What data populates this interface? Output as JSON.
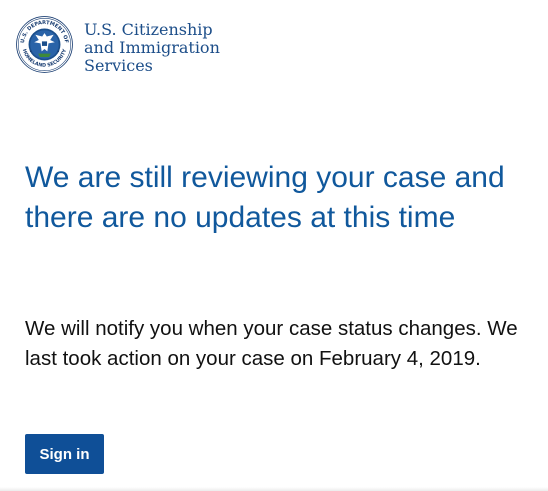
{
  "header": {
    "agency_line1": "U.S. Citizenship",
    "agency_line2": "and Immigration",
    "agency_line3": "Services",
    "seal_icon": "dhs-seal-icon",
    "seal_text_top": "U.S. DEPARTMENT OF",
    "seal_text_bottom": "HOMELAND SECURITY"
  },
  "main": {
    "headline": "We are still reviewing your case and there are no updates at this time",
    "message": "We will notify you when your case status changes. We last took action on your case on February 4, 2019."
  },
  "actions": {
    "sign_in_label": "Sign in"
  },
  "colors": {
    "brand_blue": "#10589c",
    "button_blue": "#0f4f97",
    "agency_text": "#1d4e89"
  }
}
